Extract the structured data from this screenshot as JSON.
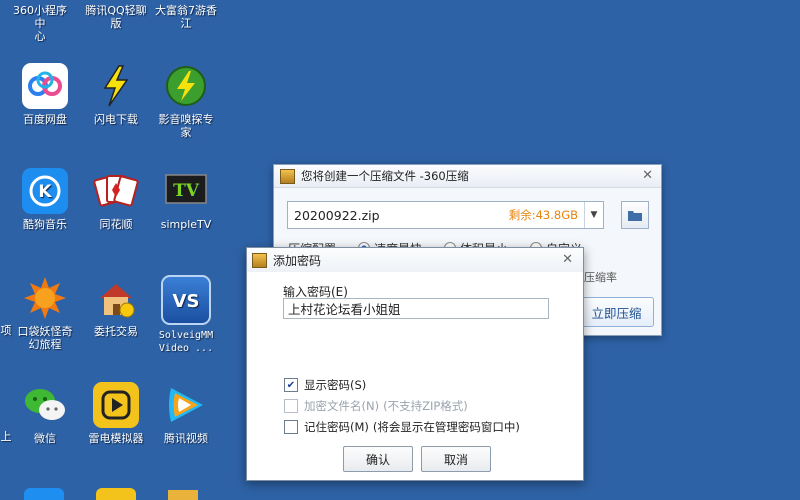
{
  "desktop": {
    "top_row": [
      "360小程序中\n心",
      "腾讯QQ轻聊\n版",
      "大富翁7游香\n江"
    ],
    "icons": [
      {
        "label": "百度网盘",
        "icon": "baidu-netdisk-icon",
        "color": "#ffffff"
      },
      {
        "label": "闪电下载",
        "icon": "flash-download-icon",
        "color": "#2e62a6"
      },
      {
        "label": "影音嗅探专\n家",
        "icon": "video-sniffer-icon",
        "color": "#2e62a6"
      },
      {
        "label": "酷狗音乐",
        "icon": "kugou-icon",
        "color": "#1d8ef0"
      },
      {
        "label": "同花顺",
        "icon": "tonghuashun-icon",
        "color": "#2e62a6"
      },
      {
        "label": "simpleTV",
        "icon": "simpletv-icon",
        "color": "#2e62a6"
      },
      {
        "label": "口袋妖怪奇\n幻旅程",
        "icon": "pokemon-game-icon",
        "color": "#2e62a6"
      },
      {
        "label": "委托交易",
        "icon": "trading-house-icon",
        "color": "#2e62a6"
      },
      {
        "label": "SolveigMM\nVideo ...",
        "icon": "solveigmm-icon",
        "color": "#2e62a6"
      },
      {
        "label": "微信",
        "icon": "wechat-icon",
        "color": "#2e62a6"
      },
      {
        "label": "雷电模拟器",
        "icon": "ldplayer-icon",
        "color": "#f3c31b"
      },
      {
        "label": "腾讯视频",
        "icon": "tencent-video-icon",
        "color": "#2e62a6"
      }
    ],
    "edge_fragments": [
      "项",
      "上"
    ]
  },
  "compress_window": {
    "title": "您将创建一个压缩文件 -360压缩",
    "filename": "20200922.zip",
    "remaining": "剩余:43.8GB",
    "config_label": "压缩配置",
    "options": [
      "速度最快",
      "体积最小",
      "自定义"
    ],
    "ratio_label": "压缩率",
    "compress_button": "立即压缩"
  },
  "password_dialog": {
    "title": "添加密码",
    "input_label": "输入密码(E)",
    "password_value": "上村花论坛看小姐姐",
    "show_password": "显示密码(S)",
    "encrypt_filename": "加密文件名(N)",
    "encrypt_note": "(不支持ZIP格式)",
    "remember_password": "记住密码(M)",
    "remember_note": "(将会显示在管理密码窗口中)",
    "ok": "确认",
    "cancel": "取消"
  }
}
